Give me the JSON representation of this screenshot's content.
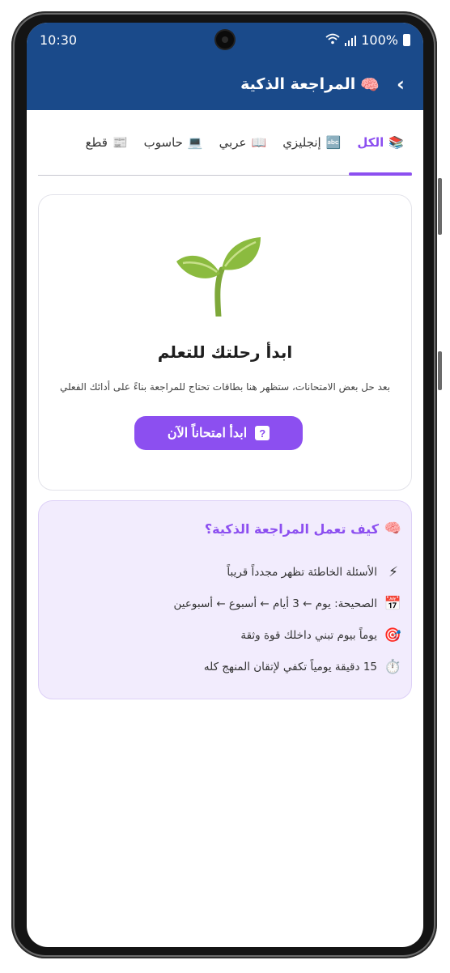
{
  "status": {
    "time": "10:30",
    "battery": "100%"
  },
  "appbar": {
    "title": "المراجعة الذكية",
    "title_icon": "brain-icon",
    "back_icon": "chevron-right-icon"
  },
  "tabs": [
    {
      "label": "الكل",
      "icon": "📚",
      "active": true
    },
    {
      "label": "إنجليزي",
      "icon": "🔤",
      "active": false
    },
    {
      "label": "عربي",
      "icon": "📖",
      "active": false
    },
    {
      "label": "حاسوب",
      "icon": "💻",
      "active": false
    },
    {
      "label": "قطع",
      "icon": "📰",
      "active": false
    }
  ],
  "empty_state": {
    "icon": "sprout-icon",
    "heading": "ابدأ رحلتك للتعلم",
    "description": "بعد حل بعض الامتحانات، ستظهر هنا بطاقات تحتاج للمراجعة بناءً على أدائك الفعلي",
    "cta_label": "ابدأ امتحاناً الآن"
  },
  "info": {
    "title": "كيف تعمل المراجعة الذكية؟",
    "title_icon": "🧠",
    "items": [
      {
        "icon": "⚡",
        "text": "الأسئلة الخاطئة تظهر مجدداً قريباً"
      },
      {
        "icon": "📅",
        "text": "الصحيحة: يوم ← 3 أيام ← أسبوع ← أسبوعين"
      },
      {
        "icon": "🎯",
        "text": "يوماً بيوم تبني داخلك قوة وثقة"
      },
      {
        "icon": "⏱️",
        "text": "15 دقيقة يومياً تكفي لإتقان المنهج كله"
      }
    ]
  },
  "colors": {
    "appbar": "#1a4a8a",
    "accent": "#8c4ff0",
    "info_bg": "#f2ecfd"
  }
}
